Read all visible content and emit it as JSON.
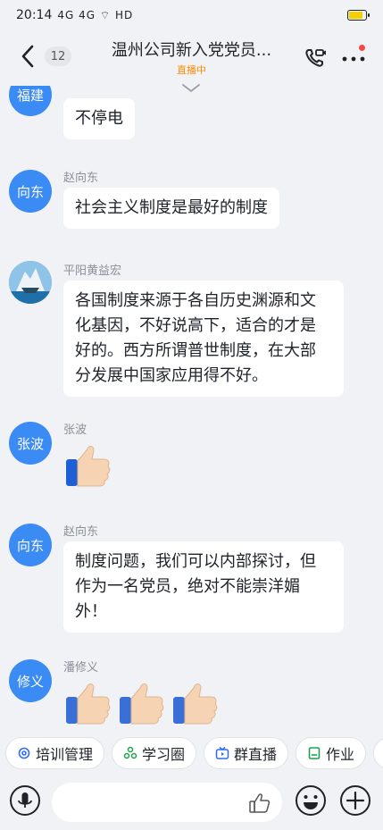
{
  "status": {
    "time": "20:14",
    "signals": "4G 4G ⌔ HD"
  },
  "header": {
    "title": "温州公司新入党党员...",
    "subtitle": "直播中",
    "back_count": "12"
  },
  "messages": [
    {
      "sender": "",
      "avatar": "福建",
      "text": "不停电"
    },
    {
      "sender": "赵向东",
      "avatar": "向东",
      "text": "社会主义制度是最好的制度"
    },
    {
      "sender": "平阳黄益宏",
      "avatar": "",
      "text_lines": [
        "各国制度来源于各自历史渊源和文",
        "化基因，不好说高下，适合的才是",
        "好的。西方所谓普世制度，在大部",
        "分发展中国家应用得不好。"
      ]
    },
    {
      "sender": "张波",
      "avatar": "张波",
      "sticker": "thumbs-up"
    },
    {
      "sender": "赵向东",
      "avatar": "向东",
      "text_lines": [
        "制度问题，我们可以内部探讨，但",
        "作为一名党员，绝对不能崇洋媚",
        "外！"
      ]
    },
    {
      "sender": "潘修义",
      "avatar": "修义",
      "sticker": "thumbs-up x3"
    }
  ],
  "toolbar": [
    {
      "label": "培训管理",
      "icon": "gear-icon",
      "color": "#2f6bf5"
    },
    {
      "label": "学习圈",
      "icon": "circle-icon",
      "color": "#1aa24a"
    },
    {
      "label": "群直播",
      "icon": "tv-icon",
      "color": "#2f6bf5"
    },
    {
      "label": "作业",
      "icon": "notebook-icon",
      "color": "#1aa24a"
    },
    {
      "label": "",
      "icon": "folder-icon",
      "color": "#1aa24a"
    }
  ],
  "colors": {
    "avatar_blue": "#3b8bf5",
    "live_orange": "#ff8a00",
    "bg": "#f1f2f5"
  }
}
